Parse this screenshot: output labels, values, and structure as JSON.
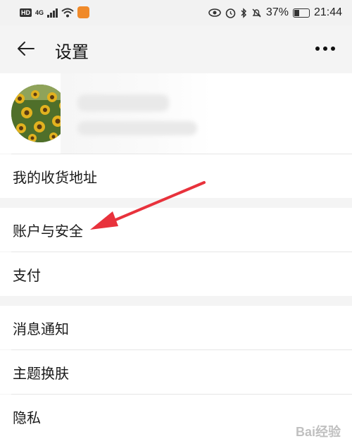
{
  "status_bar": {
    "left_badge": "HD",
    "network": "4G",
    "battery_percent": "37%",
    "time": "21:44",
    "icons": [
      "hd-icon",
      "signal-icon",
      "wifi-icon",
      "app-notification-icon",
      "eye-icon",
      "alarm-icon",
      "bluetooth-icon",
      "mute-icon",
      "battery-icon"
    ]
  },
  "header": {
    "title": "设置",
    "back_icon": "back-arrow-icon",
    "more_icon": "more-dots-icon"
  },
  "profile": {
    "avatar": "sunflower-avatar"
  },
  "groups": [
    {
      "items": [
        {
          "label": "我的收货地址"
        }
      ]
    },
    {
      "items": [
        {
          "label": "账户与安全"
        },
        {
          "label": "支付"
        }
      ]
    },
    {
      "items": [
        {
          "label": "消息通知"
        },
        {
          "label": "主题换肤"
        },
        {
          "label": "隐私"
        }
      ]
    }
  ],
  "annotation": {
    "color": "#e8323c",
    "target": "账户与安全"
  },
  "watermark": "Bai经验"
}
